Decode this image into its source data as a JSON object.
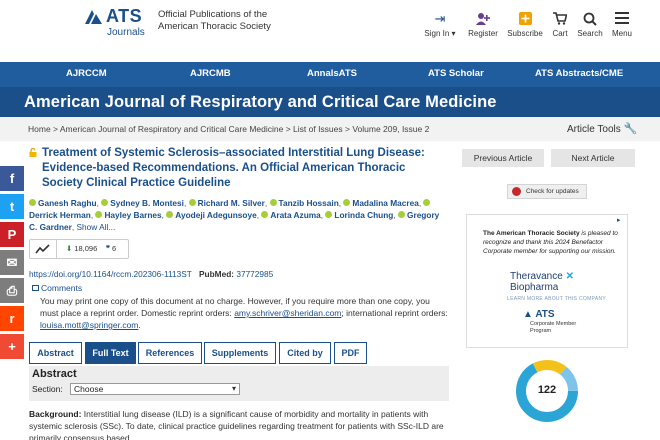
{
  "header": {
    "logo_text": "ATS",
    "logo_sub": "Journals",
    "official": "Official Publications of the American Thoracic Society",
    "tools": [
      {
        "label": "Sign In ▾",
        "icon": "sign-in-icon"
      },
      {
        "label": "Register",
        "icon": "register-icon"
      },
      {
        "label": "Subscribe",
        "icon": "subscribe-icon"
      },
      {
        "label": "Cart",
        "icon": "cart-icon"
      },
      {
        "label": "Search",
        "icon": "search-icon"
      },
      {
        "label": "Menu",
        "icon": "menu-icon"
      }
    ]
  },
  "nav": {
    "items": [
      "AJRCCM",
      "AJRCMB",
      "AnnalsATS",
      "ATS Scholar",
      "ATS Abstracts/CME"
    ]
  },
  "journal_title": "American Journal of Respiratory and Critical Care Medicine",
  "breadcrumb": "Home > American Journal of Respiratory and Critical Care Medicine > List of Issues > Volume 209, Issue 2",
  "article_tools": "Article Tools",
  "share": [
    {
      "name": "facebook",
      "glyph": "f",
      "color": "#3b5998"
    },
    {
      "name": "twitter",
      "glyph": "t",
      "color": "#1da1f2"
    },
    {
      "name": "pinterest",
      "glyph": "P",
      "color": "#cb2027"
    },
    {
      "name": "email",
      "glyph": "✉",
      "color": "#7d7d7d"
    },
    {
      "name": "print",
      "glyph": "⎙",
      "color": "#7d7d7d"
    },
    {
      "name": "reddit",
      "glyph": "r",
      "color": "#ff4500"
    },
    {
      "name": "more",
      "glyph": "+",
      "color": "#f04a35"
    }
  ],
  "article": {
    "title": "Treatment of Systemic Sclerosis–associated Interstitial Lung Disease: Evidence-based Recommendations. An Official American Thoracic Society Clinical Practice Guideline",
    "authors": [
      "Ganesh Raghu",
      "Sydney B. Montesi",
      "Richard M. Silver",
      "Tanzib Hossain",
      "Madalina Macrea",
      "Derrick Herman",
      "Hayley Barnes",
      "Ayodeji Adegunsoye",
      "Arata Azuma",
      "Lorinda Chung",
      "Gregory C. Gardner"
    ],
    "show_all": "Show All...",
    "downloads": "18,096",
    "citations": "6",
    "doi": "https://doi.org/10.1164/rccm.202306-1113ST",
    "pubmed_label": "PubMed:",
    "pubmed_id": "37772985",
    "comments": "Comments",
    "reprint_text": "You may print one copy of this document at no charge. However, if you require more than one copy, you must place a reprint order. Domestic reprint orders:",
    "reprint_email1": "amy.schriver@sheridan.com",
    "reprint_text2": "; international reprint orders:",
    "reprint_email2": "louisa.mott@springer.com",
    "reprint_end": "."
  },
  "tabs": [
    "Abstract",
    "Full Text",
    "References",
    "Supplements",
    "Cited by",
    "PDF"
  ],
  "active_tab": "Full Text",
  "abstract": {
    "heading": "Abstract",
    "section_label": "Section:",
    "section_value": "Choose",
    "background_label": "Background:",
    "background_text": "Interstitial lung disease (ILD) is a significant cause of morbidity and mortality in patients with systemic sclerosis (SSc). To date, clinical practice guidelines regarding treatment for patients with SSc-ILD are primarily consensus based."
  },
  "sidebar": {
    "prev": "Previous Article",
    "next": "Next Article",
    "check_updates": "Check for updates",
    "ad": {
      "text_pre": "The American Thoracic Society",
      "text_post": " is pleased to recognize and thank this 2024 Benefactor Corporate member for supporting our mission.",
      "sponsor_line1": "Theravance",
      "sponsor_line2": "Biopharma",
      "learn_more": "LEARN MORE ABOUT THIS COMPANY",
      "logo": "ATS",
      "corp_line1": "Corporate Member",
      "corp_line2": "Program"
    },
    "altmetric_score": "122"
  }
}
